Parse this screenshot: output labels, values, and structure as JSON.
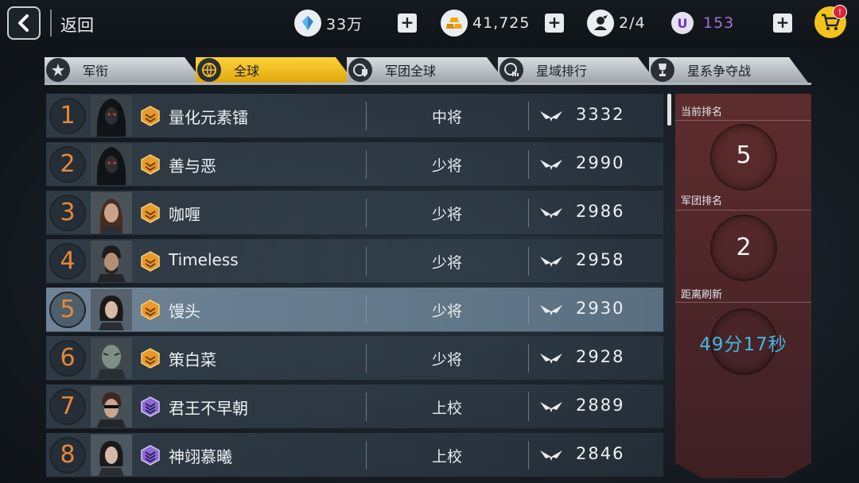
{
  "header": {
    "back_label": "返回",
    "crystal_value": "33万",
    "gold_value": "41,725",
    "squad_value": "2/4",
    "u_value": "153",
    "plus_symbol": "+",
    "u_symbol": "U",
    "cart_badge": "!",
    "icons": [
      "back-arrow-icon",
      "crystal-icon",
      "gold-bars-icon",
      "squad-icon",
      "u-credit-icon",
      "cart-icon"
    ]
  },
  "tabs": [
    {
      "label": "军衔",
      "icon": "insignia-star-icon",
      "active": false
    },
    {
      "label": "全球",
      "icon": "global-icon",
      "active": true
    },
    {
      "label": "军团全球",
      "icon": "legion-global-icon",
      "active": false
    },
    {
      "label": "星域排行",
      "icon": "star-domain-icon",
      "active": false
    },
    {
      "label": "星系争夺战",
      "icon": "trophy-icon",
      "active": false
    }
  ],
  "rankings": [
    {
      "rank": "1",
      "name": "量化元素镭",
      "title": "中将",
      "score": "3332",
      "badge": "gold",
      "self": false
    },
    {
      "rank": "2",
      "name": "善与恶",
      "title": "少将",
      "score": "2990",
      "badge": "gold",
      "self": false
    },
    {
      "rank": "3",
      "name": "咖喱",
      "title": "少将",
      "score": "2986",
      "badge": "gold",
      "self": false
    },
    {
      "rank": "4",
      "name": "Timeless",
      "title": "少将",
      "score": "2958",
      "badge": "gold",
      "self": false
    },
    {
      "rank": "5",
      "name": "馒头",
      "title": "少将",
      "score": "2930",
      "badge": "gold",
      "self": true
    },
    {
      "rank": "6",
      "name": "策白菜",
      "title": "少将",
      "score": "2928",
      "badge": "gold",
      "self": false
    },
    {
      "rank": "7",
      "name": "君王不早朝",
      "title": "上校",
      "score": "2889",
      "badge": "purple",
      "self": false
    },
    {
      "rank": "8",
      "name": "神翊慕曦",
      "title": "上校",
      "score": "2846",
      "badge": "purple",
      "self": false
    }
  ],
  "panel": {
    "current_rank_label": "当前排名",
    "current_rank_value": "5",
    "legion_rank_label": "军团排名",
    "legion_rank_value": "2",
    "refresh_label": "距离刷新",
    "refresh_value": "49分17秒"
  },
  "colors": {
    "tab_active": "#f5bf1e",
    "rank_number": "#e6883a",
    "refresh_text": "#3fb8e6",
    "panel_bg": "#5e2c2e",
    "u_currency": "#a06fd8"
  }
}
